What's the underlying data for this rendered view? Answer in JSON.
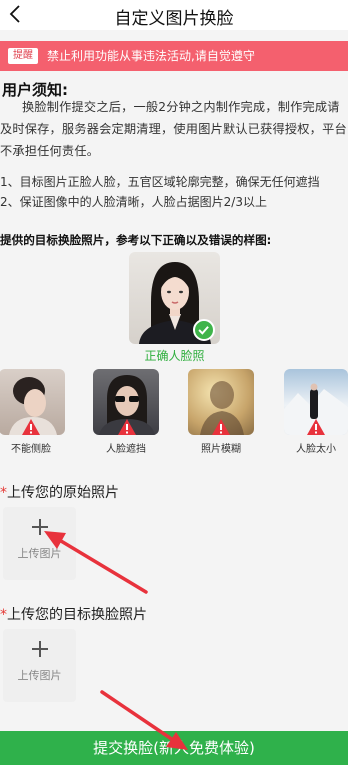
{
  "header": {
    "title": "自定义图片换脸",
    "back_icon": "chevron-left-icon"
  },
  "notice": {
    "tag": "提醒",
    "text": "禁止利用功能从事违法活动,请自觉遵守"
  },
  "user_notice": {
    "heading": "用户须知:",
    "paragraph": "换脸制作提交之后，一般2分钟之内制作完成，制作完成请及时保存，服务器会定期清理，使用图片默认已获得授权，平台不承担任何责任。",
    "rules": [
      "1、目标图片正脸人脸，五官区域轮廓完整，确保无任何遮挡",
      "2、保证图像中的人脸清晰，人脸占据图片2/3以上"
    ]
  },
  "samples": {
    "heading": "提供的目标换脸照片，参考以下正确以及错误的样图:",
    "correct_label": "正确人脸照",
    "wrong": [
      {
        "label": "不能侧脸"
      },
      {
        "label": "人脸遮挡"
      },
      {
        "label": "照片模糊"
      },
      {
        "label": "人脸太小"
      }
    ]
  },
  "upload_original": {
    "star": "*",
    "title": "上传您的原始照片",
    "button_label": "上传图片"
  },
  "upload_target": {
    "star": "*",
    "title": "上传您的目标换脸照片",
    "button_label": "上传图片"
  },
  "submit": {
    "label": "提交换脸(新人免费体验)"
  },
  "colors": {
    "accent_green": "#2fb14b",
    "notice_red": "#f4606e",
    "annotation_red": "#e8323c"
  }
}
